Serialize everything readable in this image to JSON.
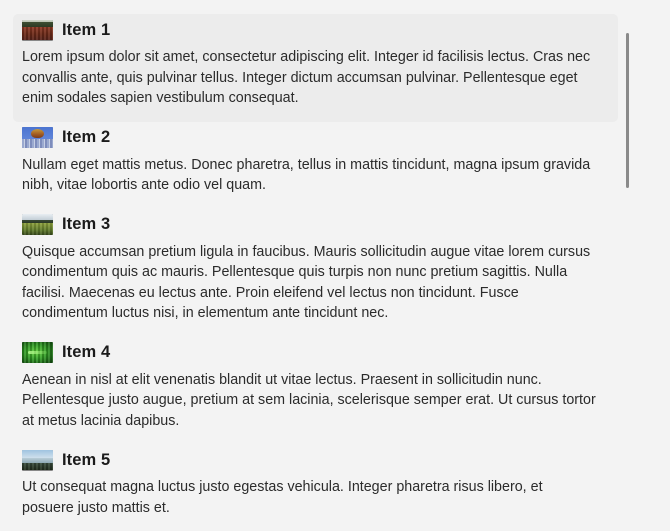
{
  "window": {
    "background_color": "#f3f3f3",
    "selection_color": "#ececec"
  },
  "scrollbar": {
    "name": "vertical-scrollbar",
    "thumb_color": "#8a8a8a",
    "position": "right"
  },
  "list": {
    "name": "item-list",
    "selected_index": 0,
    "items": [
      {
        "title": "Item 1",
        "body": "Lorem ipsum dolor sit amet, consectetur adipiscing elit. Integer id facilisis lectus. Cras nec convallis ante, quis pulvinar tellus. Integer dictum accumsan pulvinar. Pellentesque eget enim sodales sapien vestibulum consequat.",
        "thumbnail": "poppy-field-thumbnail",
        "selected": true
      },
      {
        "title": "Item 2",
        "body": "Nullam eget mattis metus. Donec pharetra, tellus in mattis tincidunt, magna ipsum gravida nibh, vitae lobortis ante odio vel quam.",
        "thumbnail": "hot-air-balloon-thumbnail",
        "selected": false
      },
      {
        "title": "Item 3",
        "body": "Quisque accumsan pretium ligula in faucibus. Mauris sollicitudin augue vitae lorem cursus condimentum quis ac mauris. Pellentesque quis turpis non nunc pretium sagittis. Nulla facilisi. Maecenas eu lectus ante. Proin eleifend vel lectus non tincidunt. Fusce condimentum luctus nisi, in elementum ante tincidunt nec.",
        "thumbnail": "green-valley-thumbnail",
        "selected": false
      },
      {
        "title": "Item 4",
        "body": "Aenean in nisl at elit venenatis blandit ut vitae lectus. Praesent in sollicitudin nunc. Pellentesque justo augue, pretium at sem lacinia, scelerisque semper erat. Ut cursus tortor at metus lacinia dapibus.",
        "thumbnail": "green-foliage-thumbnail",
        "selected": false
      },
      {
        "title": "Item 5",
        "body": "Ut consequat magna luctus justo egestas vehicula. Integer pharetra risus libero, et posuere justo mattis et.",
        "thumbnail": "coastal-landscape-thumbnail",
        "selected": false
      }
    ]
  }
}
